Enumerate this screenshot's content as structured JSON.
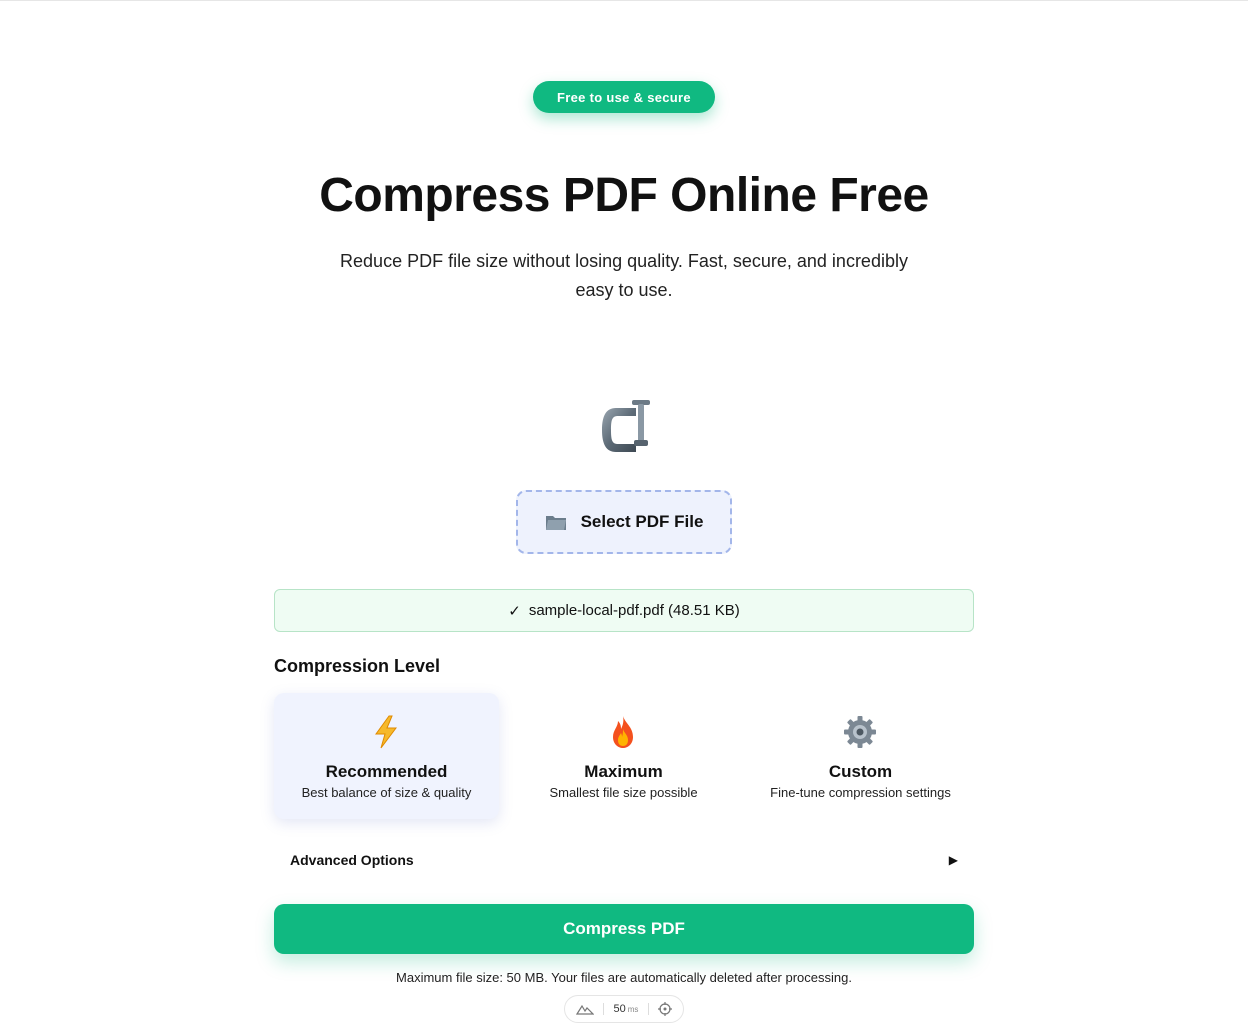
{
  "badge": "Free to use & secure",
  "hero": {
    "title": "Compress PDF Online Free",
    "subtitle": "Reduce PDF file size without losing quality. Fast, secure, and incredibly easy to use."
  },
  "upload": {
    "icon": "clamp-icon",
    "select_button": "Select PDF File",
    "select_icon": "folder-icon"
  },
  "selected_file": {
    "check": "✓",
    "label": "sample-local-pdf.pdf (48.51 KB)"
  },
  "compression": {
    "heading": "Compression Level",
    "levels": [
      {
        "icon": "lightning-icon",
        "name": "Recommended",
        "desc": "Best balance of size & quality",
        "selected": true
      },
      {
        "icon": "fire-icon",
        "name": "Maximum",
        "desc": "Smallest file size possible",
        "selected": false
      },
      {
        "icon": "gear-icon",
        "name": "Custom",
        "desc": "Fine-tune compression settings",
        "selected": false
      }
    ]
  },
  "advanced": {
    "label": "Advanced Options",
    "arrow": "▶"
  },
  "compress_button": "Compress PDF",
  "footnote": "Maximum file size: 50 MB. Your files are automatically deleted after processing.",
  "perf_widget": {
    "value": "50",
    "unit": "ms"
  },
  "colors": {
    "accent": "#10b981",
    "select_bg": "#eef2fd",
    "file_bar_bg": "#effcf3"
  }
}
